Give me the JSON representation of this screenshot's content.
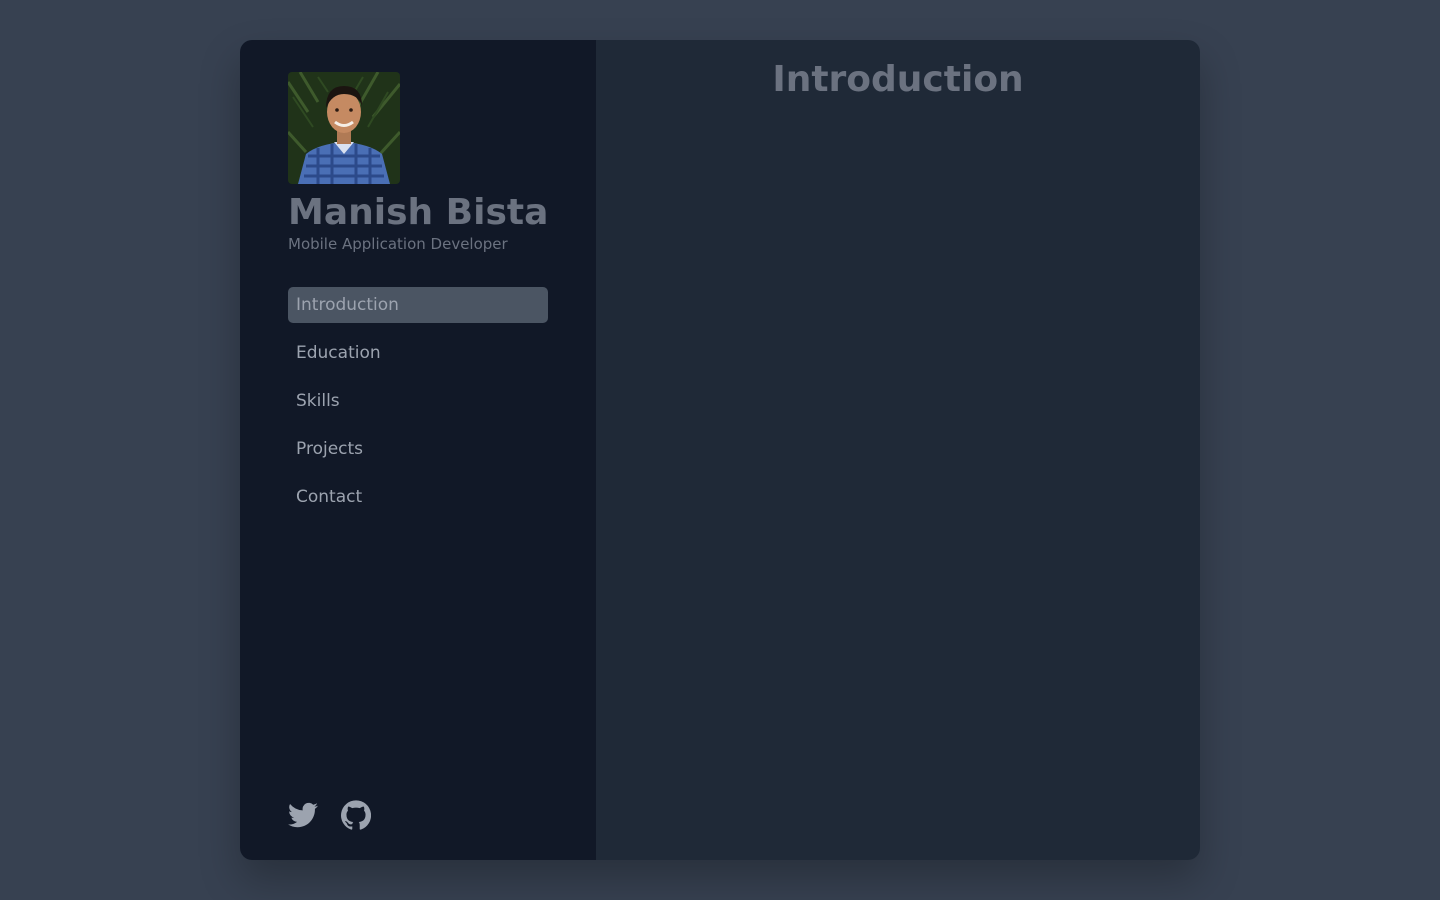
{
  "profile": {
    "name": "Manish Bista",
    "role": "Mobile Application Developer"
  },
  "nav": {
    "items": [
      {
        "label": "Introduction",
        "active": true
      },
      {
        "label": "Education",
        "active": false
      },
      {
        "label": "Skills",
        "active": false
      },
      {
        "label": "Projects",
        "active": false
      },
      {
        "label": "Contact",
        "active": false
      }
    ]
  },
  "social": {
    "icons": [
      "twitter-icon",
      "github-icon"
    ]
  },
  "main": {
    "title": "Introduction"
  },
  "colors": {
    "page_bg": "#374151",
    "sidebar_bg": "#111827",
    "main_bg": "#1f2937",
    "active_nav_bg": "#4b5563",
    "muted_text": "#6b7280"
  }
}
